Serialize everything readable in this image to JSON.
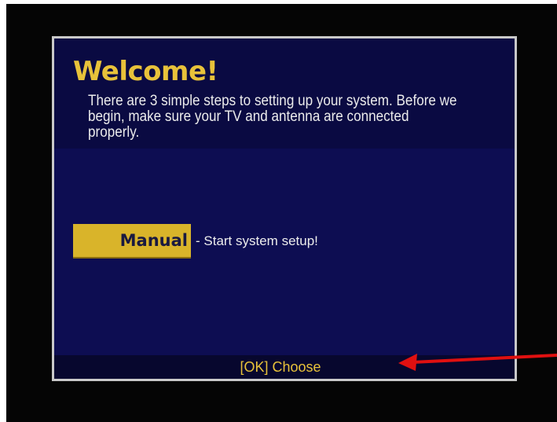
{
  "dialog": {
    "title": "Welcome!",
    "intro": "There are 3 simple steps to setting up your system. Before we begin, make sure your TV and antenna are connected properly.",
    "menu": {
      "button_label": "Manual",
      "description": "- Start system setup!"
    },
    "footer_hint": "[OK] Choose"
  },
  "colors": {
    "title": "#e8c23a",
    "dialog_bg": "#0d0d52",
    "highlight": "#d9b42a",
    "annotation_arrow": "#e01010"
  },
  "annotation": {
    "icon": "red-arrow-icon"
  }
}
